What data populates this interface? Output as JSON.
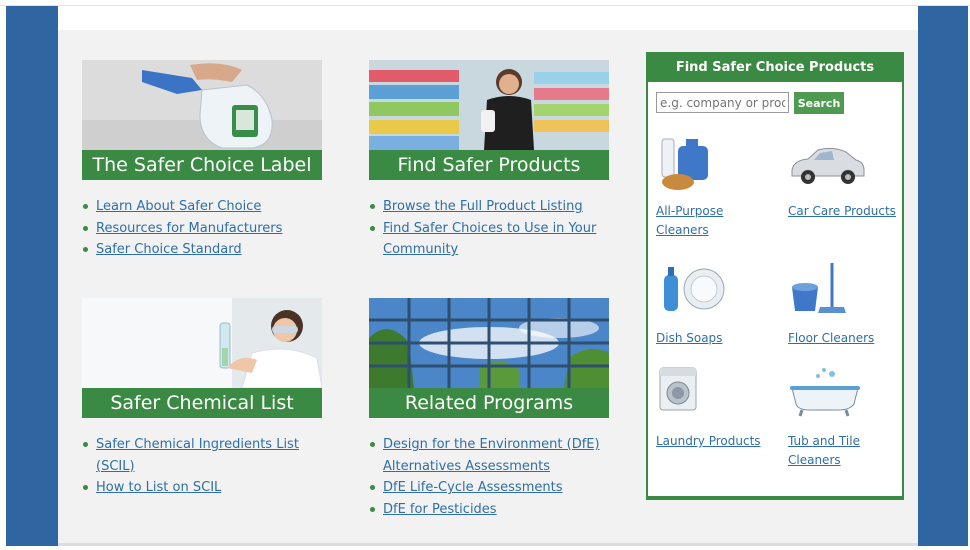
{
  "cards": {
    "label": {
      "title": "The Safer Choice Label",
      "links": [
        "Learn About Safer Choice",
        "Resources for Manufacturers",
        "Safer Choice Standard"
      ]
    },
    "products": {
      "title": "Find Safer Products",
      "links": [
        "Browse the Full Product Listing",
        "Find Safer Choices to Use in Your Community"
      ]
    },
    "chemical": {
      "title": "Safer Chemical List",
      "links": [
        "Safer Chemical Ingredients List (SCIL)",
        "How to List on SCIL"
      ]
    },
    "programs": {
      "title": "Related Programs",
      "links": [
        "Design for the Environment (DfE) Alternatives Assessments",
        "DfE Life-Cycle Assessments",
        "DfE for Pesticides"
      ]
    }
  },
  "sidebar": {
    "title": "Find Safer Choice Products",
    "search_placeholder": "e.g. company or product",
    "search_button": "Search",
    "categories": [
      {
        "label": "All-Purpose Cleaners",
        "icon": "cleaner-bottles-icon"
      },
      {
        "label": "Car Care Products",
        "icon": "car-icon"
      },
      {
        "label": "Dish Soaps",
        "icon": "dish-soap-icon"
      },
      {
        "label": "Floor Cleaners",
        "icon": "mop-bucket-icon"
      },
      {
        "label": "Laundry Products",
        "icon": "washing-machine-icon"
      },
      {
        "label": "Tub and Tile Cleaners",
        "icon": "bathtub-icon"
      }
    ]
  },
  "colors": {
    "brand_green": "#3b8a44",
    "frame_blue": "#2f65a0",
    "link_blue": "#2f6fa5"
  }
}
